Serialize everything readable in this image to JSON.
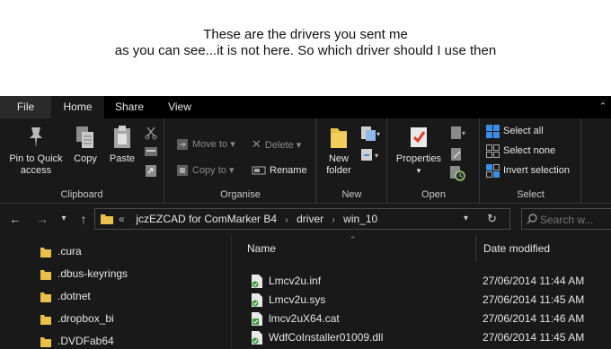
{
  "caption": {
    "line1": "These are the drivers you sent me",
    "line2": "as you can see...it is not here. So which driver should I use then"
  },
  "tabs": [
    "File",
    "Home",
    "Share",
    "View"
  ],
  "ribbon": {
    "clipboard": {
      "label": "Clipboard",
      "pin_line1": "Pin to Quick",
      "pin_line2": "access",
      "copy": "Copy",
      "paste": "Paste"
    },
    "organise": {
      "label": "Organise",
      "move_to": "Move to",
      "copy_to": "Copy to",
      "delete": "Delete",
      "rename": "Rename"
    },
    "new": {
      "label": "New",
      "new_line1": "New",
      "new_line2": "folder"
    },
    "open": {
      "label": "Open",
      "properties": "Properties"
    },
    "select": {
      "label": "Select",
      "select_all": "Select all",
      "select_none": "Select none",
      "invert": "Invert selection"
    }
  },
  "address": {
    "prefix": "«",
    "crumbs": [
      "jczEZCAD for ComMarker B4",
      "driver",
      "win_10"
    ]
  },
  "search": {
    "placeholder": "Search w..."
  },
  "nav_items": [
    ".cura",
    ".dbus-keyrings",
    ".dotnet",
    ".dropbox_bi",
    ".DVDFab64"
  ],
  "columns": {
    "name": "Name",
    "date": "Date modified"
  },
  "files": [
    {
      "name": "Lmcv2u.inf",
      "date": "27/06/2014 11:44 AM",
      "icon": "inf-file-icon"
    },
    {
      "name": "Lmcv2u.sys",
      "date": "27/06/2014 11:45 AM",
      "icon": "sys-file-icon"
    },
    {
      "name": "lmcv2uX64.cat",
      "date": "27/06/2014 11:46 AM",
      "icon": "cat-file-icon"
    },
    {
      "name": "WdfCoInstaller01009.dll",
      "date": "27/06/2014 11:45 AM",
      "icon": "dll-file-icon"
    }
  ],
  "colors": {
    "background": "#191919",
    "tab_bar": "#000000",
    "folder_yellow": "#e8c04a",
    "accent_blue": "#3a8ee6"
  }
}
